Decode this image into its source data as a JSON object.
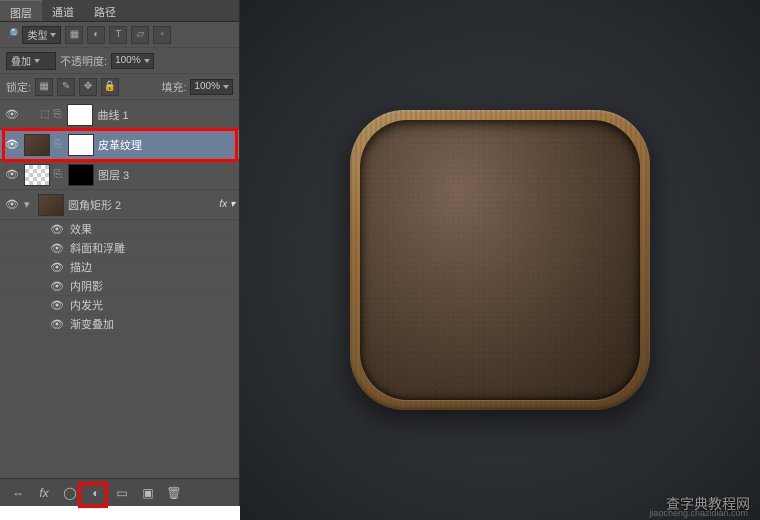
{
  "tabs": {
    "layers": "图层",
    "channels": "通道",
    "paths": "路径"
  },
  "filter": {
    "label": "类型"
  },
  "blend": {
    "mode": "叠加",
    "opacity_label": "不透明度:",
    "opacity": "100%"
  },
  "lock": {
    "label": "锁定:",
    "fill_label": "填充:",
    "fill": "100%"
  },
  "layers_list": {
    "curves": {
      "name": "曲线 1"
    },
    "leather": {
      "name": "皮革纹理"
    },
    "layer3": {
      "name": "图层 3"
    },
    "round_rect": {
      "name": "圆角矩形 2"
    },
    "effects_label": "效果",
    "effects": [
      "斜面和浮雕",
      "描边",
      "内阴影",
      "内发光",
      "渐变叠加"
    ]
  },
  "bottom_icons": {
    "link": "⇔",
    "fx": "fx",
    "mask": "◯",
    "adj": "◐",
    "group": "▭",
    "new": "▣",
    "trash": "🗑"
  },
  "watermark": {
    "main": "查字典教程网",
    "sub": "jiaocheng.chazidian.com"
  }
}
